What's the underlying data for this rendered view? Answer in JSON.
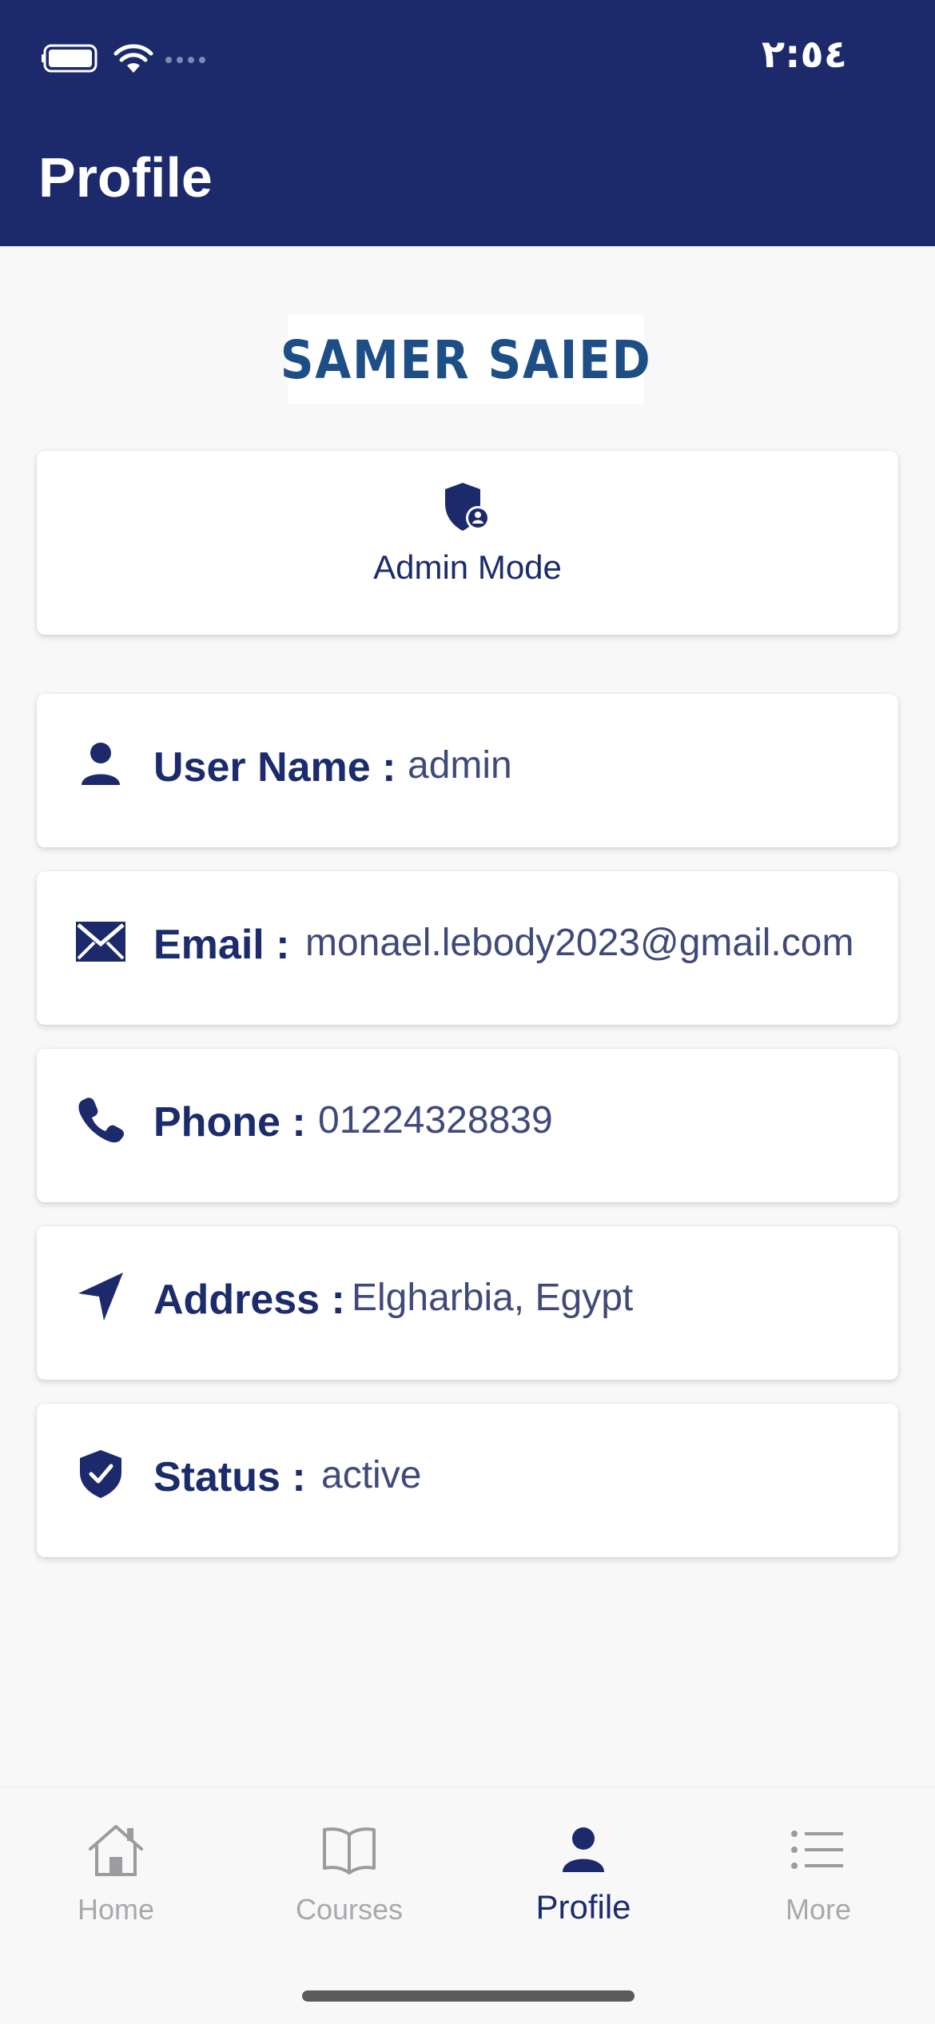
{
  "status_bar": {
    "time": "٢:٥٤",
    "icons": [
      "battery-icon",
      "wifi-icon",
      "signal-icon"
    ]
  },
  "header": {
    "title": "Profile"
  },
  "logo": {
    "text": "SAMER SAIED"
  },
  "admin_mode": {
    "icon": "admin-shield-icon",
    "label": "Admin Mode"
  },
  "info": [
    {
      "icon": "user-icon",
      "label": "User Name :",
      "value": "admin"
    },
    {
      "icon": "envelope-icon",
      "label": "Email :",
      "value": "monael.lebody2023@gmail.com"
    },
    {
      "icon": "phone-icon",
      "label": "Phone :",
      "value": "01224328839"
    },
    {
      "icon": "location-arrow-icon",
      "label": "Address :",
      "value": "Elgharbia, Egypt"
    },
    {
      "icon": "shield-check-icon",
      "label": "Status :",
      "value": "active"
    }
  ],
  "tabs": [
    {
      "icon": "home-icon",
      "label": "Home",
      "active": false
    },
    {
      "icon": "book-icon",
      "label": "Courses",
      "active": false
    },
    {
      "icon": "person-icon",
      "label": "Profile",
      "active": true
    },
    {
      "icon": "list-icon",
      "label": "More",
      "active": false
    }
  ],
  "colors": {
    "primary": "#1c2a6b",
    "logo": "#1d4f86",
    "value_text": "#404a78",
    "inactive_tab": "#a9a9ad"
  }
}
